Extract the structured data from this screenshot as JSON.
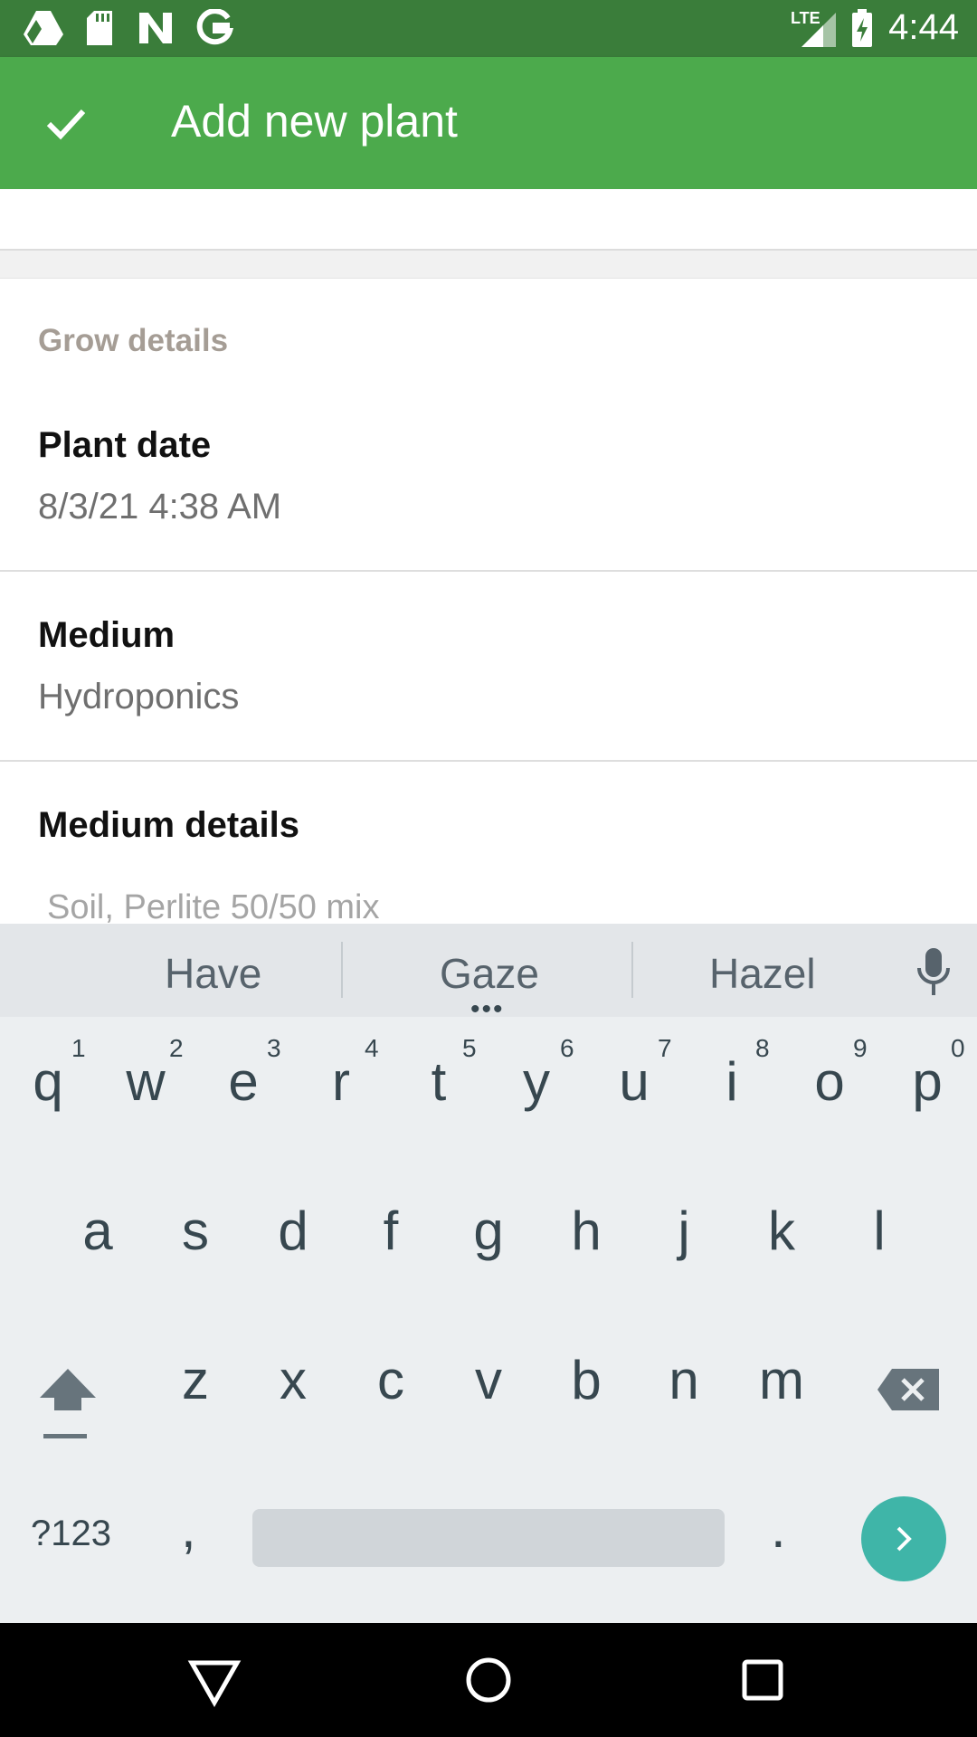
{
  "status_bar": {
    "time": "4:44",
    "network_label": "LTE",
    "left_icons": [
      "drive-icon",
      "sd-card-icon",
      "n-notification-icon",
      "google-icon"
    ]
  },
  "app_bar": {
    "title": "Add new plant",
    "confirm_icon": "check-icon",
    "background_color": "#4caa4c"
  },
  "form": {
    "section_header": "Grow details",
    "plant_date": {
      "label": "Plant date",
      "value": "8/3/21 4:38 AM"
    },
    "medium": {
      "label": "Medium",
      "value": "Hydroponics"
    },
    "medium_details": {
      "label": "Medium details",
      "placeholder": "Soil, Perlite 50/50 mix"
    }
  },
  "keyboard": {
    "suggestions": [
      "Have",
      "Gaze",
      "Hazel"
    ],
    "row1": [
      {
        "key": "q",
        "hint": "1"
      },
      {
        "key": "w",
        "hint": "2"
      },
      {
        "key": "e",
        "hint": "3"
      },
      {
        "key": "r",
        "hint": "4"
      },
      {
        "key": "t",
        "hint": "5"
      },
      {
        "key": "y",
        "hint": "6"
      },
      {
        "key": "u",
        "hint": "7"
      },
      {
        "key": "i",
        "hint": "8"
      },
      {
        "key": "o",
        "hint": "9"
      },
      {
        "key": "p",
        "hint": "0"
      }
    ],
    "row2": [
      "a",
      "s",
      "d",
      "f",
      "g",
      "h",
      "j",
      "k",
      "l"
    ],
    "row3": [
      "z",
      "x",
      "c",
      "v",
      "b",
      "n",
      "m"
    ],
    "symbols_label": "?123",
    "comma": ",",
    "period": ".",
    "accent_color": "#3fb5a8"
  },
  "nav_bar": {
    "buttons": [
      "back-icon",
      "home-icon",
      "recents-icon"
    ]
  }
}
